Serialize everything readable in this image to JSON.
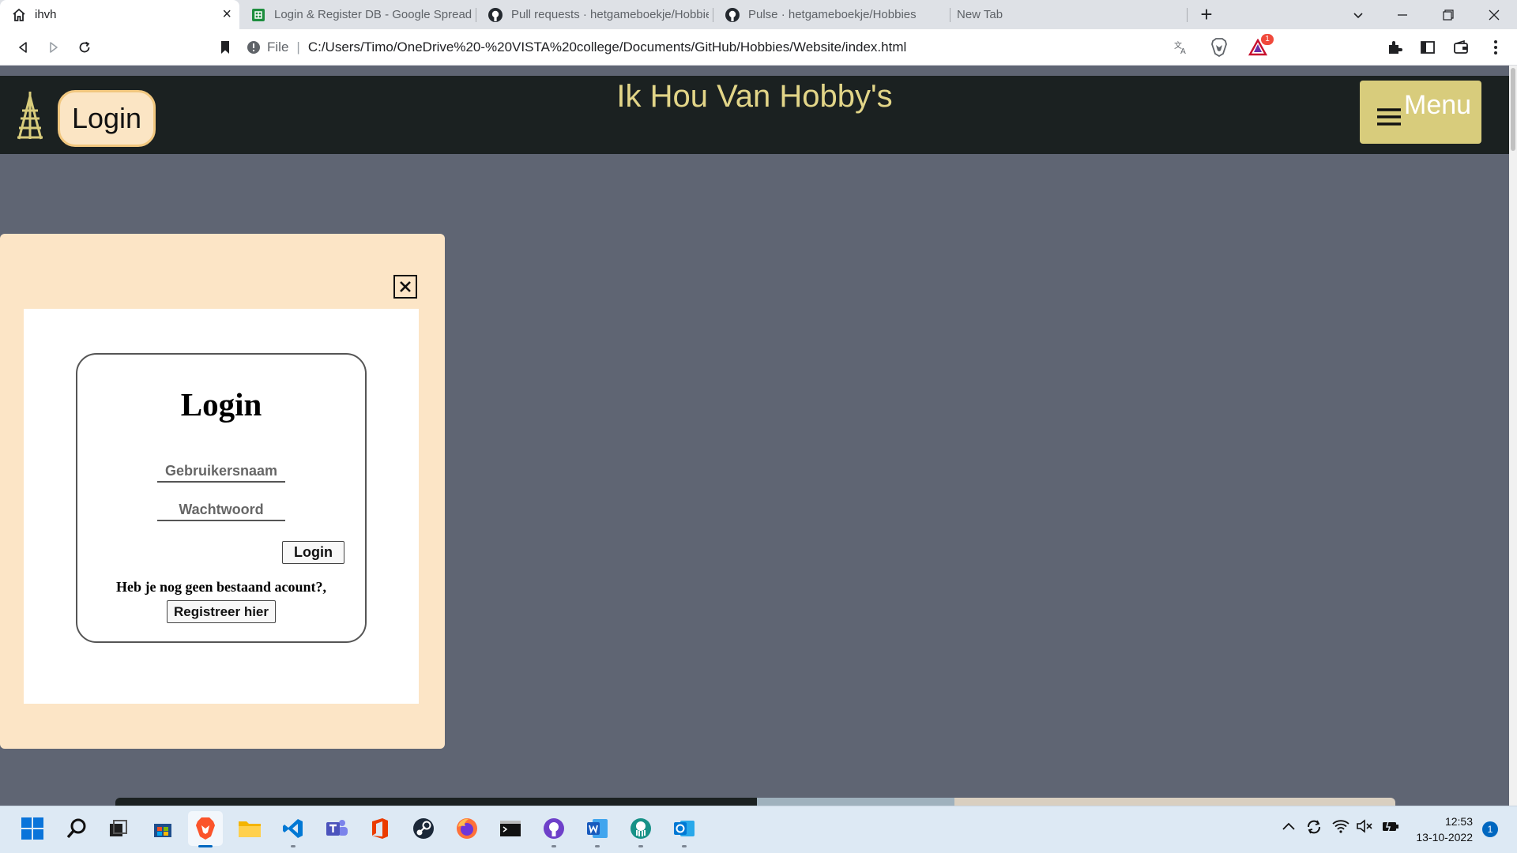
{
  "browser": {
    "tabs": [
      {
        "title": "ihvh",
        "icon": "home-icon",
        "active": true
      },
      {
        "title": "Login & Register DB - Google Spreadsheets",
        "icon": "sheets-icon"
      },
      {
        "title": "Pull requests · hetgameboekje/Hobbies",
        "icon": "github-icon"
      },
      {
        "title": "Pulse · hetgameboekje/Hobbies",
        "icon": "github-icon"
      },
      {
        "title": "New Tab",
        "icon": ""
      }
    ],
    "new_tab_label": "+",
    "address": {
      "scheme_label": "File",
      "url": "C:/Users/Timo/OneDrive%20-%20VISTA%20college/Documents/GitHub/Hobbies/Website/index.html"
    },
    "rewards_badge": "1"
  },
  "site": {
    "header_login_label": "Login",
    "title": "Ik Hou Van Hobby's",
    "menu_label": "Menu",
    "colors": {
      "header_bg": "#1b2121",
      "title": "#e2d588",
      "menu_bg": "#d8cc7c",
      "page_bg": "#5f6573",
      "modal_bg": "#fce5c6"
    }
  },
  "login_modal": {
    "heading": "Login",
    "username_placeholder": "Gebruikersnaam",
    "password_placeholder": "Wachtwoord",
    "submit_label": "Login",
    "no_account_text": "Heb je nog geen bestaand acount?,",
    "register_label": "Registreer hier"
  },
  "taskbar": {
    "apps": [
      "start-icon",
      "search-icon",
      "task-view-icon",
      "store-icon",
      "brave-icon",
      "file-explorer-icon",
      "vscode-icon",
      "teams-icon",
      "office-icon",
      "steam-icon",
      "firefox-icon",
      "terminal-icon",
      "github-desktop-icon",
      "word-icon",
      "gitkraken-icon",
      "outlook-icon"
    ],
    "time": "12:53",
    "date": "13-10-2022",
    "notification_count": "1"
  }
}
